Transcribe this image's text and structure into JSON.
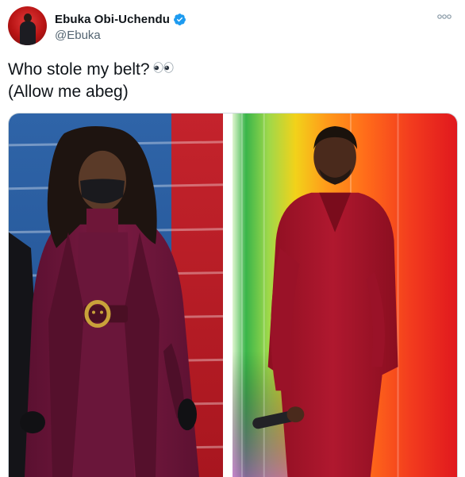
{
  "tweet": {
    "author": {
      "display_name": "Ebuka Obi-Uchendu",
      "handle": "@Ebuka",
      "verified": true,
      "avatar_icon": "profile-photo-avatar"
    },
    "text_lines": [
      "Who stole my belt?",
      "(Allow me abeg)"
    ],
    "emoji": "eyes-emoji",
    "more_icon": "more-options-icon",
    "media": {
      "photos": [
        {
          "name": "left-photo",
          "description_icon": "woman-in-burgundy-coat-photo"
        },
        {
          "name": "right-photo",
          "description_icon": "man-in-red-suit-photo"
        }
      ]
    },
    "colors": {
      "verified_blue": "#1d9bf0",
      "handle_gray": "#536471",
      "text": "#0f1419"
    }
  }
}
